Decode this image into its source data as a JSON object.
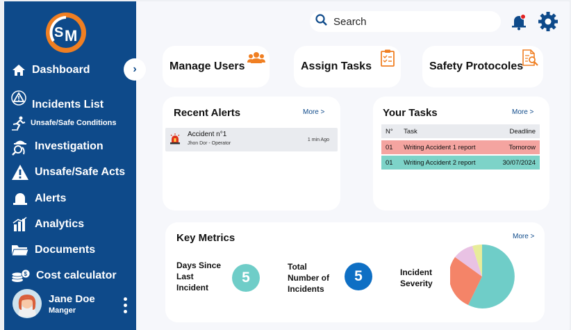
{
  "sidebar": {
    "collapse_glyph": "›",
    "items": [
      {
        "label": "Dashboard",
        "icon": "home-icon"
      },
      {
        "label": "Incidents List",
        "icon": "warning-triangle-icon"
      },
      {
        "label": "Unsafe/Safe Conditions",
        "icon": "slip-person-icon"
      },
      {
        "label": "Investigation",
        "icon": "detective-icon"
      },
      {
        "label": "Unsafe/Safe Acts",
        "icon": "alert-triangle-icon"
      },
      {
        "label": "Alerts",
        "icon": "bell-icon"
      },
      {
        "label": "Analytics",
        "icon": "bar-chart-icon"
      },
      {
        "label": "Documents",
        "icon": "folder-icon"
      },
      {
        "label": "Cost calculator",
        "icon": "coins-icon"
      }
    ],
    "user": {
      "name": "Jane Doe",
      "role": "Manger"
    }
  },
  "header": {
    "search_placeholder": "Search"
  },
  "quick_actions": [
    {
      "label": "Manage Users",
      "icon": "users-icon"
    },
    {
      "label": "Assign Tasks",
      "icon": "clipboard-icon"
    },
    {
      "label": "Safety Protocoles",
      "icon": "document-search-icon"
    }
  ],
  "recent_alerts": {
    "title": "Recent Alerts",
    "more": "More >",
    "items": [
      {
        "title": "Accident n°1",
        "subtitle": "Jhon Dor - Operator",
        "time": "1 min Ago"
      }
    ]
  },
  "your_tasks": {
    "title": "Your Tasks",
    "more": "More >",
    "headers": {
      "no": "N°",
      "task": "Task",
      "deadline": "Deadline"
    },
    "rows": [
      {
        "no": "01",
        "task": "Writing Accident 1 report",
        "deadline": "Tomorow"
      },
      {
        "no": "01",
        "task": "Writing Accident 2 report",
        "deadline": "30/07/2024"
      }
    ]
  },
  "key_metrics": {
    "title": "Key Metrics",
    "more": "More >",
    "days_label": "Days Since Last Incident",
    "days_value": "5",
    "total_label": "Total Number of Incidents",
    "total_value": "5",
    "severity_label": "Incident Severity"
  },
  "colors": {
    "sidebar_bg": "#0e4a8a",
    "accent_orange": "#f07f22",
    "teal": "#6fcdc8",
    "blue": "#0e6fc4",
    "red_row": "#f4a4a0",
    "green_row": "#7dd3c8"
  }
}
